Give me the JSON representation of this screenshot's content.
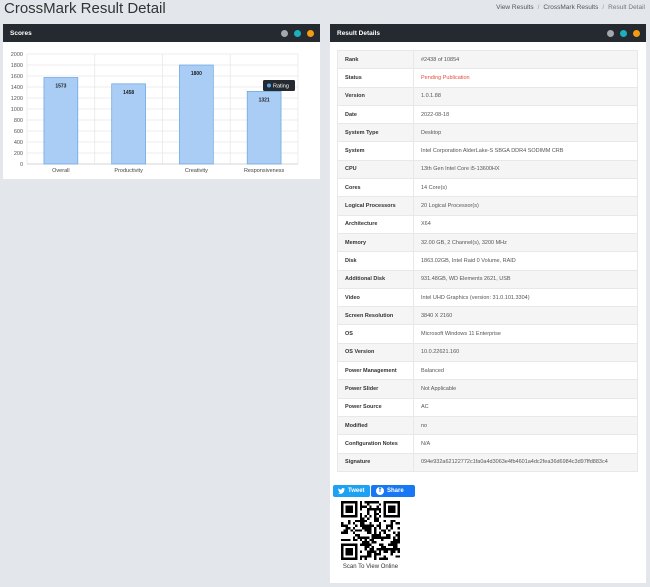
{
  "header": {
    "title": "CrossMark Result Detail",
    "breadcrumb": [
      "View Results",
      "CrossMark Results",
      "Result Detail"
    ]
  },
  "scores_panel": {
    "title": "Scores",
    "legend": "Rating"
  },
  "chart_data": {
    "type": "bar",
    "categories": [
      "Overall",
      "Productivity",
      "Creativity",
      "Responsiveness"
    ],
    "series": [
      {
        "name": "Rating",
        "values": [
          1573,
          1458,
          1800,
          1321
        ]
      }
    ],
    "ylim": [
      0,
      2000
    ],
    "yticks": [
      0,
      200,
      400,
      600,
      800,
      1000,
      1200,
      1400,
      1600,
      1800,
      2000
    ],
    "grid": true,
    "legend_position": "top-right",
    "colors": {
      "bar_fill": "#a9cdf5",
      "bar_stroke": "#6aa3e0"
    }
  },
  "details_panel": {
    "title": "Result Details",
    "rows": [
      {
        "label": "Rank",
        "value": "#2438 of 10854"
      },
      {
        "label": "Status",
        "value": "Pending Publication"
      },
      {
        "label": "Version",
        "value": "1.0.1.88"
      },
      {
        "label": "Date",
        "value": "2022-08-18"
      },
      {
        "label": "System Type",
        "value": "Desktop"
      },
      {
        "label": "System",
        "value": "Intel Corporation AlderLake-S SBGA DDR4 SODIMM CRB"
      },
      {
        "label": "CPU",
        "value": "13th Gen Intel Core i5-13600HX"
      },
      {
        "label": "Cores",
        "value": "14 Core(s)"
      },
      {
        "label": "Logical Processors",
        "value": "20 Logical Processor(s)"
      },
      {
        "label": "Architecture",
        "value": "X64"
      },
      {
        "label": "Memory",
        "value": "32.00 GB, 2 Channel(s), 3200 MHz"
      },
      {
        "label": "Disk",
        "value": "1863.02GB, Intel Raid 0 Volume, RAID"
      },
      {
        "label": "Additional Disk",
        "value": "931.48GB, WD Elements 2621, USB"
      },
      {
        "label": "Video",
        "value": "Intel UHD Graphics (version: 31.0.101.3304)"
      },
      {
        "label": "Screen Resolution",
        "value": "3840 X 2160"
      },
      {
        "label": "OS",
        "value": "Microsoft Windows 11 Enterprise"
      },
      {
        "label": "OS Version",
        "value": "10.0.22621.160"
      },
      {
        "label": "Power Management",
        "value": "Balanced"
      },
      {
        "label": "Power Slider",
        "value": "Not Applicable"
      },
      {
        "label": "Power Source",
        "value": "AC"
      },
      {
        "label": "Modified",
        "value": "no"
      },
      {
        "label": "Configuration Notes",
        "value": "N/A"
      },
      {
        "label": "Signature",
        "value": "094e932a62122772c1fa0a4d3063e4fb4601a4dc2fea36d6984c3d97ffd883c4"
      }
    ],
    "tweet_label": "Tweet",
    "share_label": "Share",
    "qr_caption": "Scan To View Online"
  },
  "colors": {
    "panel_header": "#252a30",
    "status_pending": "#e74c3c",
    "tweet": "#1da1f2",
    "facebook": "#1877f2"
  }
}
